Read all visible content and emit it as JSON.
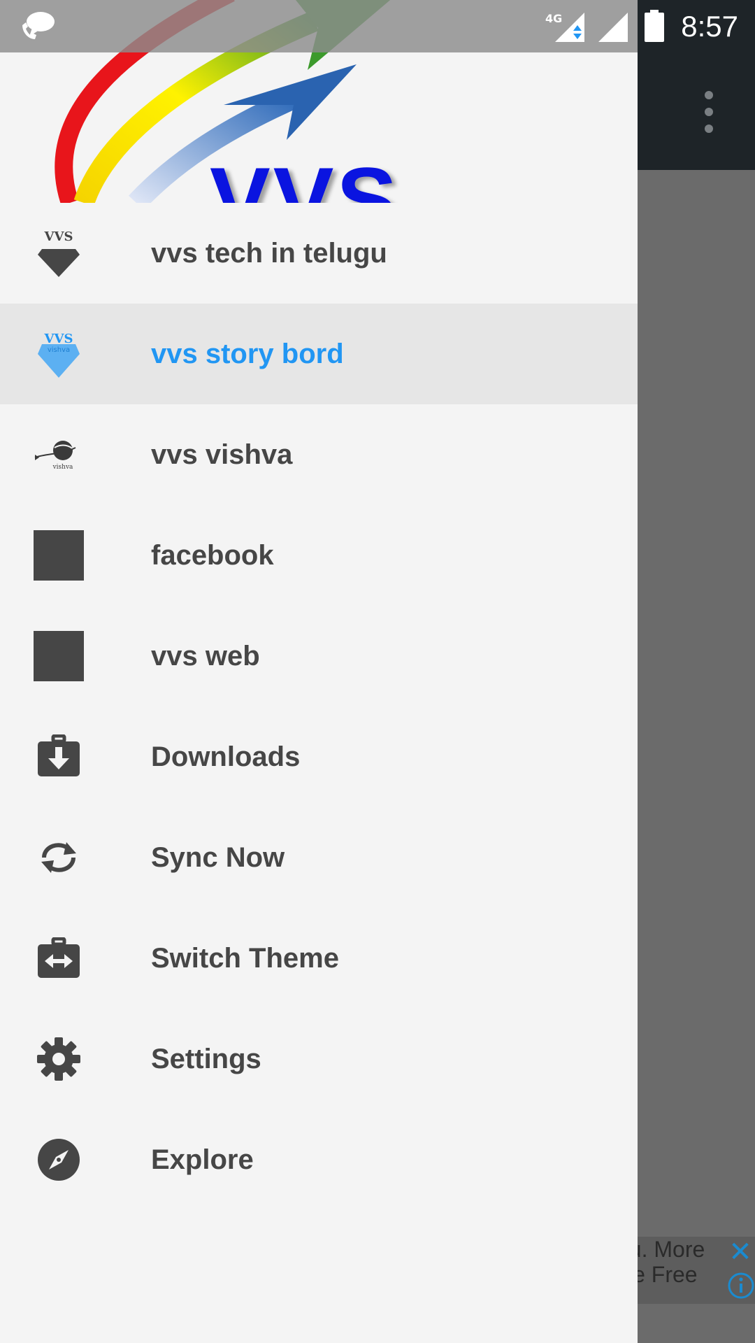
{
  "status_bar": {
    "time": "8:57",
    "network": "4G",
    "icons": [
      "whatsapp-icon",
      "signal-4g-icon",
      "signal-icon",
      "battery-icon"
    ]
  },
  "drawer": {
    "header_logo_text": "VVS",
    "items": [
      {
        "label": "vvs tech in telugu",
        "icon": "vvs-diamond-icon",
        "selected": false
      },
      {
        "label": "vvs story bord",
        "icon": "vvs-vishva-diamond-icon",
        "selected": true
      },
      {
        "label": "vvs vishva",
        "icon": "vishva-logo-icon",
        "selected": false
      },
      {
        "label": "facebook",
        "icon": "square-icon",
        "selected": false
      },
      {
        "label": "vvs web",
        "icon": "square-icon",
        "selected": false
      },
      {
        "label": "Downloads",
        "icon": "download-box-icon",
        "selected": false
      },
      {
        "label": "Sync Now",
        "icon": "sync-icon",
        "selected": false
      },
      {
        "label": "Switch Theme",
        "icon": "switch-theme-icon",
        "selected": false
      },
      {
        "label": "Settings",
        "icon": "gear-icon",
        "selected": false
      },
      {
        "label": "Explore",
        "icon": "compass-icon",
        "selected": false
      }
    ],
    "icon_small_text": {
      "vvs": "VVS",
      "vishva": "vishva"
    }
  },
  "ad": {
    "line1": "ou. More",
    "line2": "sle Free",
    "close": "✕"
  },
  "colors": {
    "accent": "#2196f3",
    "drawer_bg": "#f4f4f4",
    "selected_bg": "#e6e6e6",
    "item_text": "#464646"
  }
}
